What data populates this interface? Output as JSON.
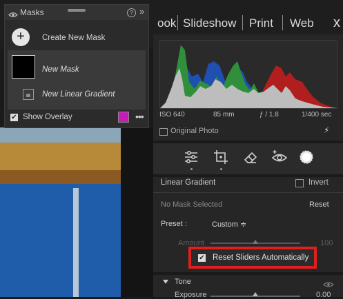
{
  "nav": {
    "partial_item": "ook",
    "items": [
      "Slideshow",
      "Print",
      "Web"
    ],
    "close_glyph": "x"
  },
  "masks_panel": {
    "title": "Masks",
    "create_label": "Create New Mask",
    "masks": [
      {
        "name": "New Mask",
        "icon": "mask-thumbnail"
      },
      {
        "name": "New Linear Gradient",
        "icon": "linear-gradient-icon"
      }
    ],
    "show_overlay_label": "Show Overlay",
    "show_overlay_checked": true,
    "overlay_color": "#c81cb8"
  },
  "histogram": {
    "iso": "ISO 640",
    "focal": "85 mm",
    "aperture": "ƒ / 1.8",
    "shutter": "1/400 sec"
  },
  "original_photo_label": "Original Photo",
  "tools": [
    "sliders-icon",
    "crop-icon",
    "eraser-icon",
    "red-eye-icon",
    "masking-icon"
  ],
  "gradient_panel": {
    "title": "Linear Gradient",
    "invert_label": "Invert",
    "no_mask": "No Mask Selected",
    "reset_label": "Reset",
    "preset_label": "Preset :",
    "preset_value": "Custom ≑",
    "amount_label": "Amount",
    "amount_value": "100",
    "reset_sliders_label": "Reset Sliders Automatically",
    "reset_sliders_checked": true,
    "highlight_color": "#e01e1e"
  },
  "tone": {
    "label": "Tone",
    "exposure_label": "Exposure",
    "exposure_value": "0.00"
  }
}
